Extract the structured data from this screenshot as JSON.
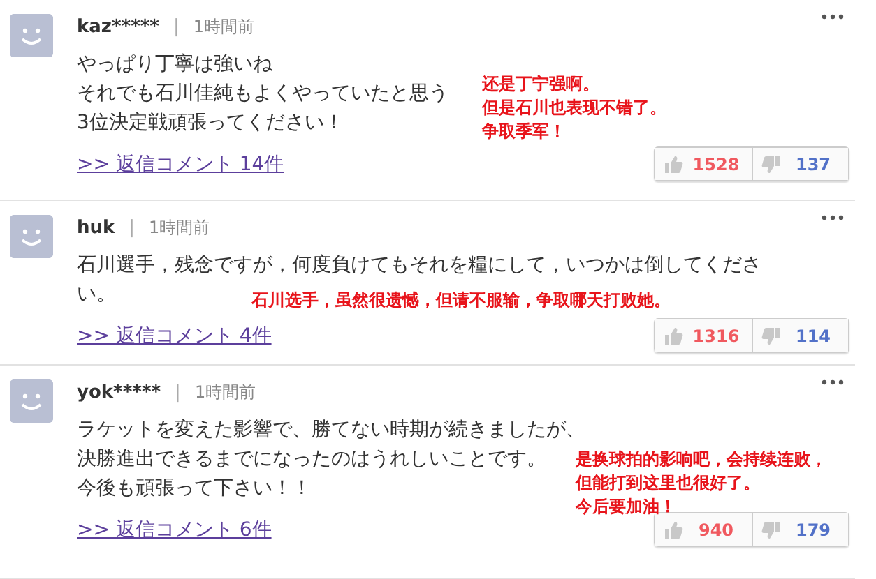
{
  "comments": [
    {
      "user": "kaz*****",
      "separator": "|",
      "time": "1時間前",
      "lines": [
        "やっぱり丁寧は強いね",
        "それでも石川佳純もよくやっていたと思う",
        "3位決定戦頑張ってください！"
      ],
      "replies": ">> 返信コメント 14件",
      "likes": "1528",
      "dislikes": "137",
      "annotation": {
        "lines": [
          "还是丁宁强啊。",
          "但是石川也表现不错了。",
          "争取季军！"
        ],
        "color": "#e8141b"
      }
    },
    {
      "user": "huk",
      "separator": "|",
      "time": "1時間前",
      "lines": [
        "石川選手，残念ですが，何度負けてもそれを糧にして，いつかは倒してくださ",
        "い。"
      ],
      "replies": ">> 返信コメント 4件",
      "likes": "1316",
      "dislikes": "114",
      "annotation": {
        "lines": [
          "石川选手，虽然很遗憾，但请不服输，争取哪天打败她。"
        ],
        "color": "#e8141b"
      }
    },
    {
      "user": "yok*****",
      "separator": "|",
      "time": "1時間前",
      "lines": [
        "ラケットを変えた影響で、勝てない時期が続きましたが、",
        "決勝進出できるまでになったのはうれしいことです。",
        "今後も頑張って下さい！！"
      ],
      "replies": ">> 返信コメント 6件",
      "likes": "940",
      "dislikes": "179",
      "annotation": {
        "lines": [
          "是换球拍的影响吧，会持续连败，",
          "但能打到这里也很好了。",
          "今后要加油！"
        ],
        "color": "#e8141b"
      }
    }
  ]
}
